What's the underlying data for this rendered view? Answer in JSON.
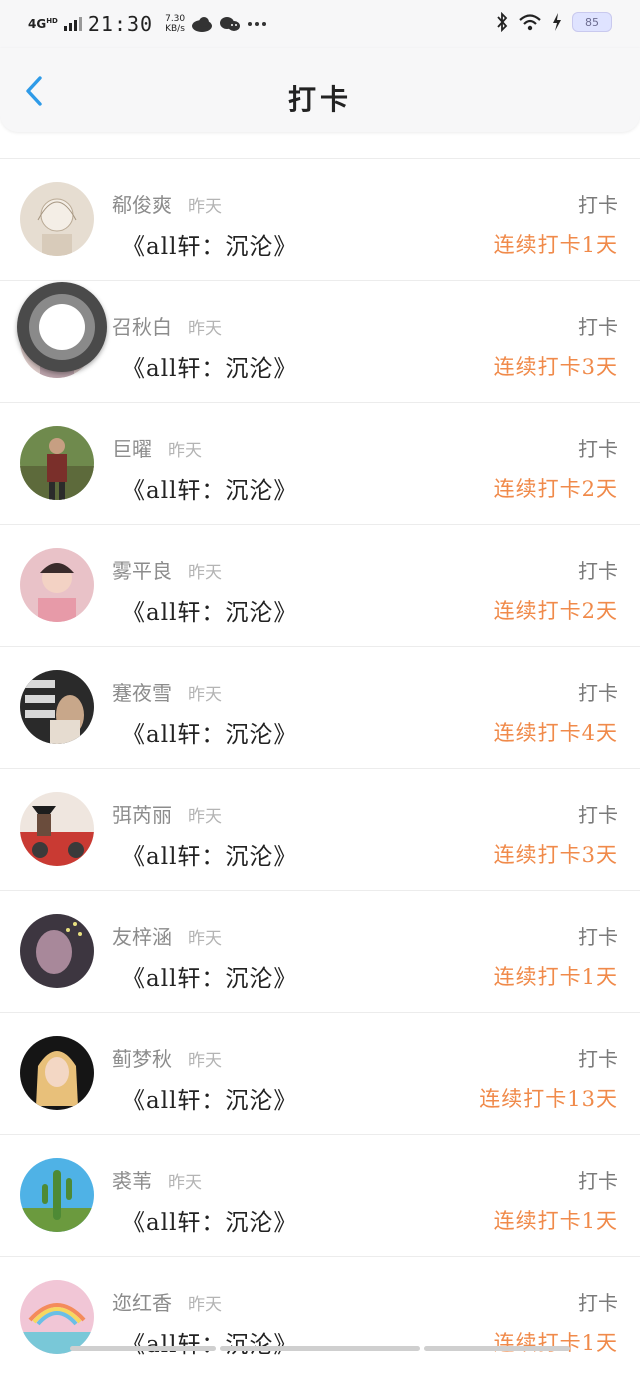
{
  "status_bar": {
    "network": "4G",
    "network_sup": "HD",
    "time": "21:30",
    "speed_value": "7.30",
    "speed_unit": "KB/s",
    "battery": "85",
    "icons": [
      "cloud-icon",
      "wechat-icon",
      "more-dots-icon",
      "bluetooth-icon",
      "wifi-icon",
      "charging-icon"
    ]
  },
  "header": {
    "title": "打卡",
    "back_icon": "chevron-left-icon",
    "accent": "#2f9be8"
  },
  "colors": {
    "streak": "#f08a4a",
    "name": "#8c8c8c",
    "action": "#7a7a7a"
  },
  "items": [
    {
      "name": "郗俊爽",
      "time": "昨天",
      "book": "《all轩：沉沦》",
      "action": "打卡",
      "streak": "连续打卡1天"
    },
    {
      "name": "召秋白",
      "time": "昨天",
      "book": "《all轩：沉沦》",
      "action": "打卡",
      "streak": "连续打卡3天"
    },
    {
      "name": "巨曜",
      "time": "昨天",
      "book": "《all轩：沉沦》",
      "action": "打卡",
      "streak": "连续打卡2天"
    },
    {
      "name": "雾平良",
      "time": "昨天",
      "book": "《all轩：沉沦》",
      "action": "打卡",
      "streak": "连续打卡2天"
    },
    {
      "name": "蹇夜雪",
      "time": "昨天",
      "book": "《all轩：沉沦》",
      "action": "打卡",
      "streak": "连续打卡4天"
    },
    {
      "name": "弭芮丽",
      "time": "昨天",
      "book": "《all轩：沉沦》",
      "action": "打卡",
      "streak": "连续打卡3天"
    },
    {
      "name": "友梓涵",
      "time": "昨天",
      "book": "《all轩：沉沦》",
      "action": "打卡",
      "streak": "连续打卡1天"
    },
    {
      "name": "蓟梦秋",
      "time": "昨天",
      "book": "《all轩：沉沦》",
      "action": "打卡",
      "streak": "连续打卡13天"
    },
    {
      "name": "裘苇",
      "time": "昨天",
      "book": "《all轩：沉沦》",
      "action": "打卡",
      "streak": "连续打卡1天"
    },
    {
      "name": "迩红香",
      "time": "昨天",
      "book": "《all轩：沉沦》",
      "action": "打卡",
      "streak": "连续打卡1天"
    }
  ]
}
